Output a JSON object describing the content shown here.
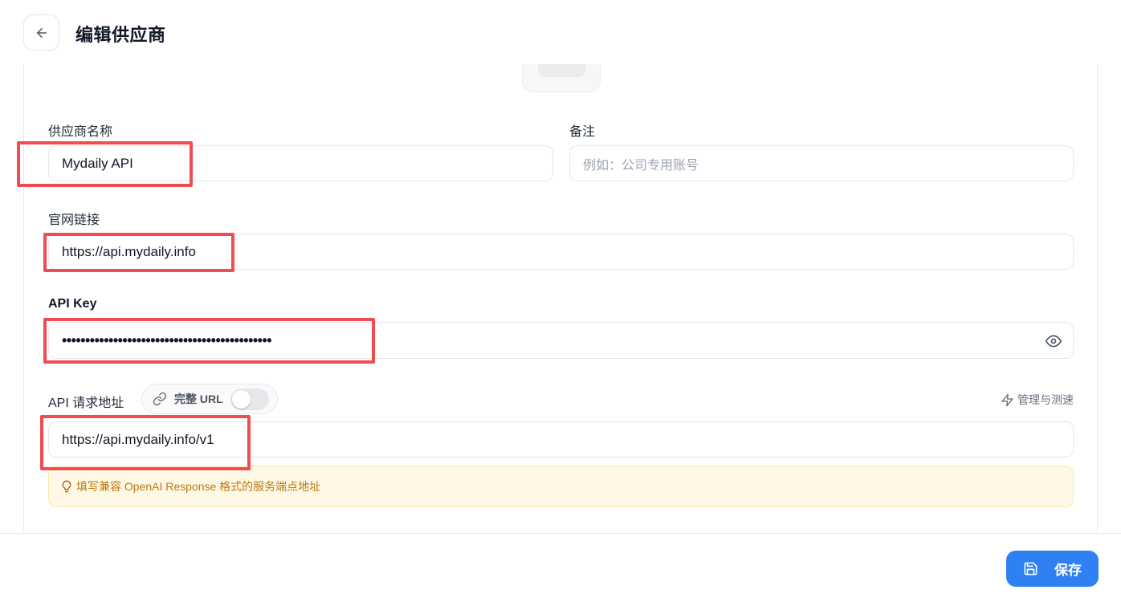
{
  "header": {
    "title": "编辑供应商"
  },
  "form": {
    "name": {
      "label": "供应商名称",
      "value": "Mydaily API"
    },
    "note": {
      "label": "备注",
      "placeholder": "例如：公司专用账号"
    },
    "website": {
      "label": "官网链接",
      "value": "https://api.mydaily.info"
    },
    "api_key": {
      "label": "API Key",
      "value": "•••••••••••••••••••••••••••••••••••••••••••••"
    },
    "endpoint": {
      "label": "API 请求地址",
      "full_url_toggle_label": "完整 URL",
      "full_url_enabled": false,
      "manage_label": "管理与测速",
      "value": "https://api.mydaily.info/v1",
      "hint": "填写兼容 OpenAI Response 格式的服务端点地址"
    }
  },
  "footer": {
    "save_label": "保存"
  },
  "colors": {
    "accent": "#2f80f2",
    "highlight": "#f04c52",
    "hint_text": "#c2770b",
    "hint_bg": "#fef9e7"
  }
}
